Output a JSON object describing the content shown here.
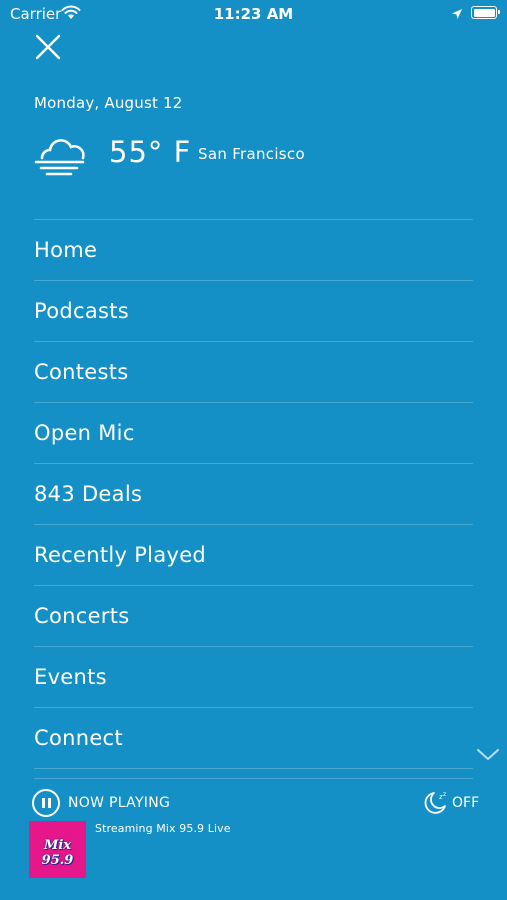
{
  "status_bar": {
    "carrier": "Carrier",
    "time": "11:23 AM",
    "icons": [
      "wifi-icon",
      "location-arrow-icon",
      "battery-icon"
    ]
  },
  "header": {
    "close_icon": "close-icon",
    "date": "Monday, August 12",
    "weather": {
      "icon": "cloud-fog-icon",
      "temperature": "55° F",
      "city": "San Francisco"
    }
  },
  "menu": {
    "items": [
      {
        "label": "Home"
      },
      {
        "label": "Podcasts"
      },
      {
        "label": "Contests"
      },
      {
        "label": "Open Mic"
      },
      {
        "label": "843 Deals"
      },
      {
        "label": "Recently Played"
      },
      {
        "label": "Concerts"
      },
      {
        "label": "Events"
      },
      {
        "label": "Connect"
      }
    ],
    "scroll_icon": "chevron-down-icon"
  },
  "player": {
    "state_icon": "pause-icon",
    "status": "NOW PLAYING",
    "sleep_timer_icon": "sleep-timer-icon",
    "sleep_timer_value": "OFF",
    "station_logo_text": "Mix 95.9",
    "station_logo_color": "#e6178a",
    "stream_title": "Streaming Mix 95.9 Live"
  },
  "colors": {
    "background": "#1490c6",
    "text": "#ffffff"
  }
}
